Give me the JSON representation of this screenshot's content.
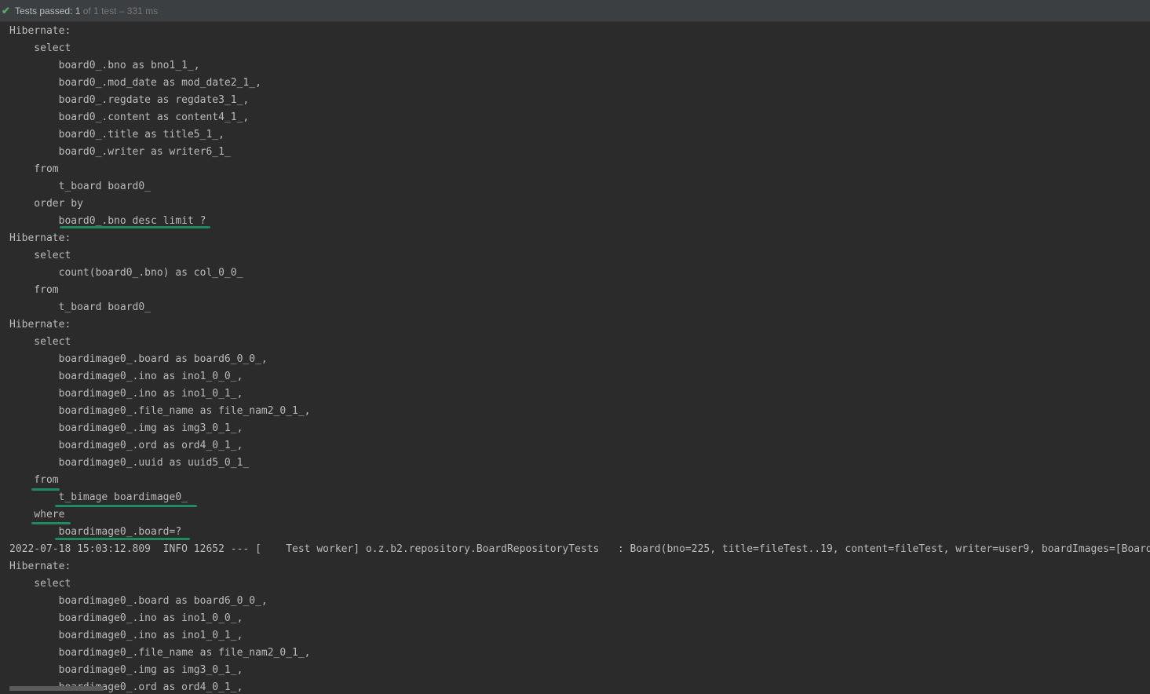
{
  "status": {
    "passed_label": "Tests passed:",
    "passed_count": "1",
    "of_text": "of 1 test – 331 ms"
  },
  "console": {
    "lines": [
      "Hibernate: ",
      "    select",
      "        board0_.bno as bno1_1_,",
      "        board0_.mod_date as mod_date2_1_,",
      "        board0_.regdate as regdate3_1_,",
      "        board0_.content as content4_1_,",
      "        board0_.title as title5_1_,",
      "        board0_.writer as writer6_1_ ",
      "    from",
      "        t_board board0_ ",
      "    order by",
      "        board0_.bno desc limit ?",
      "Hibernate: ",
      "    select",
      "        count(board0_.bno) as col_0_0_ ",
      "    from",
      "        t_board board0_",
      "Hibernate: ",
      "    select",
      "        boardimage0_.board as board6_0_0_,",
      "        boardimage0_.ino as ino1_0_0_,",
      "        boardimage0_.ino as ino1_0_1_,",
      "        boardimage0_.file_name as file_nam2_0_1_,",
      "        boardimage0_.img as img3_0_1_,",
      "        boardimage0_.ord as ord4_0_1_,",
      "        boardimage0_.uuid as uuid5_0_1_ ",
      "    from",
      "        t_bimage boardimage0_ ",
      "    where",
      "        boardimage0_.board=?",
      "2022-07-18 15:03:12.809  INFO 12652 --- [    Test worker] o.z.b2.repository.BoardRepositoryTests   : Board(bno=225, title=fileTest..19, content=fileTest, writer=user9, boardImages=[BoardImage(ino=",
      "Hibernate: ",
      "    select",
      "        boardimage0_.board as board6_0_0_,",
      "        boardimage0_.ino as ino1_0_0_,",
      "        boardimage0_.ino as ino1_0_1_,",
      "        boardimage0_.file_name as file_nam2_0_1_,",
      "        boardimage0_.img as img3_0_1_,",
      "        boardimage0_.ord as ord4_0_1_,"
    ]
  }
}
